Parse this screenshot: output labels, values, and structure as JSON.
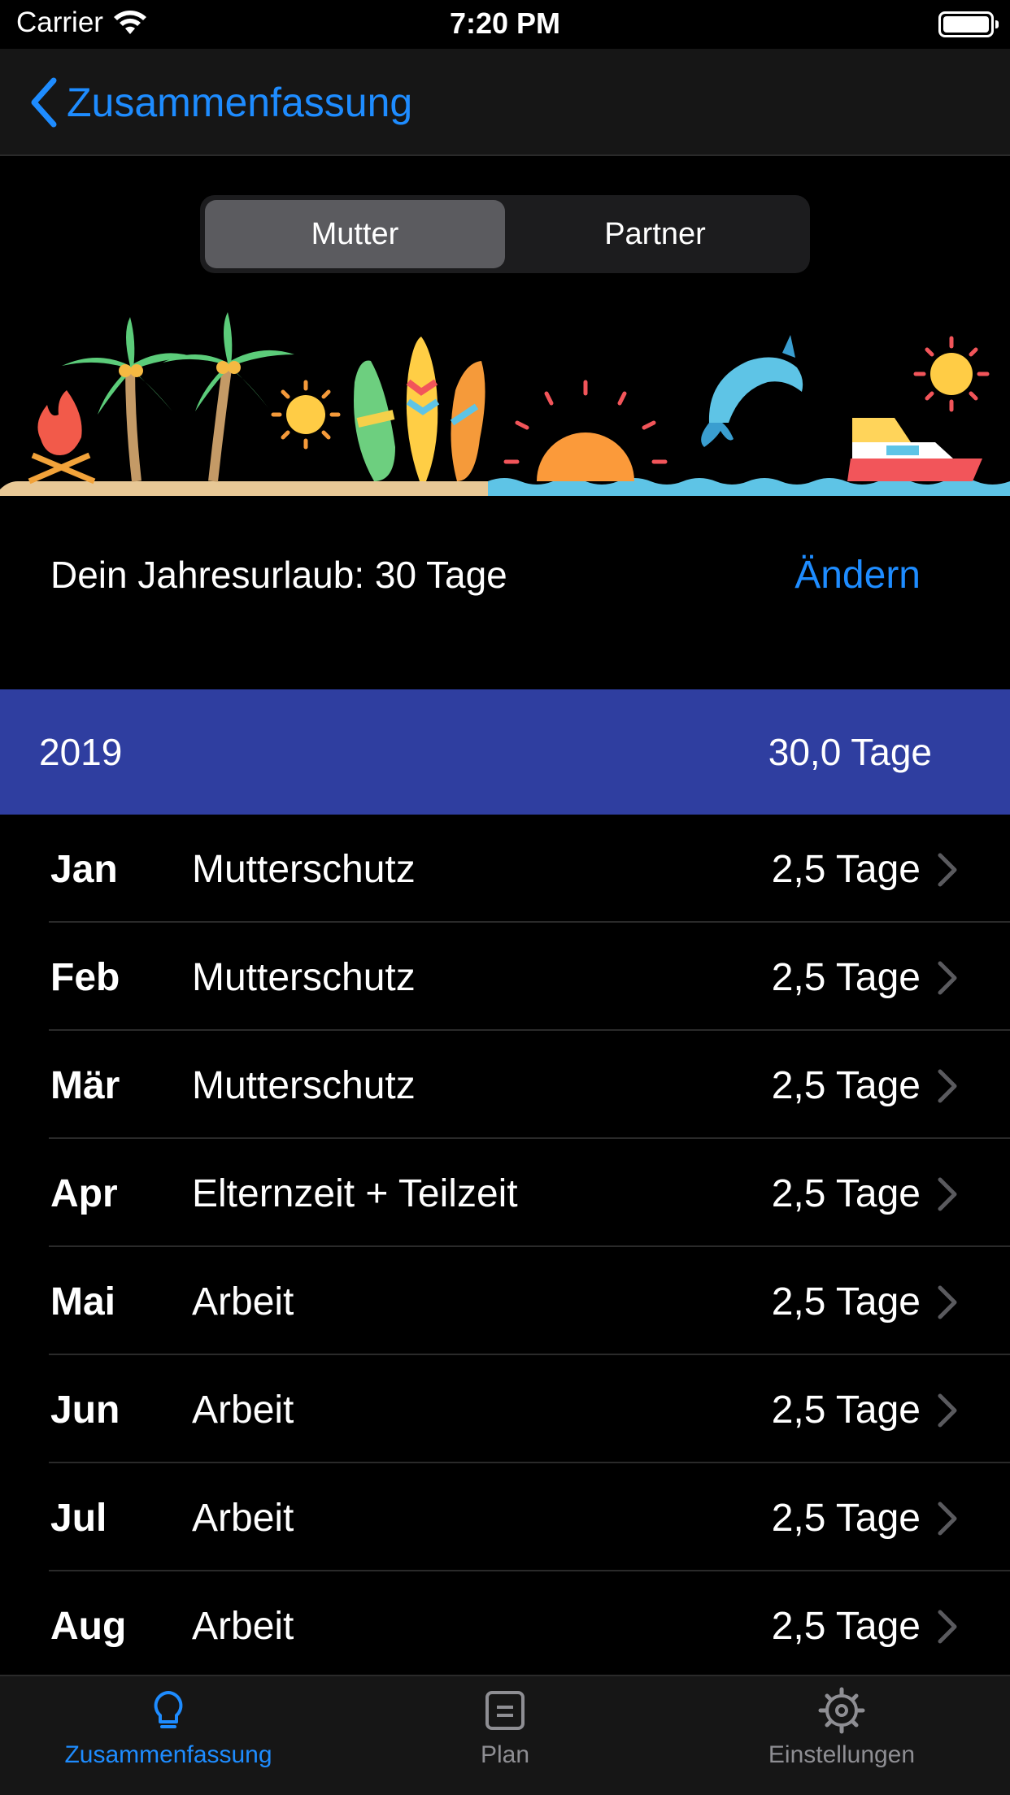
{
  "status": {
    "carrier": "Carrier",
    "time": "7:20 PM"
  },
  "nav": {
    "back_label": "Zusammenfassung"
  },
  "segments": [
    {
      "label": "Mutter",
      "active": true
    },
    {
      "label": "Partner",
      "active": false
    }
  ],
  "vacation": {
    "text": "Dein Jahresurlaub: 30 Tage",
    "change_label": "Ändern"
  },
  "year": {
    "label": "2019",
    "total": "30,0 Tage"
  },
  "months": [
    {
      "name": "Jan",
      "type": "Mutterschutz",
      "days": "2,5 Tage"
    },
    {
      "name": "Feb",
      "type": "Mutterschutz",
      "days": "2,5 Tage"
    },
    {
      "name": "Mär",
      "type": "Mutterschutz",
      "days": "2,5 Tage"
    },
    {
      "name": "Apr",
      "type": "Elternzeit + Teilzeit",
      "days": "2,5 Tage"
    },
    {
      "name": "Mai",
      "type": "Arbeit",
      "days": "2,5 Tage"
    },
    {
      "name": "Jun",
      "type": "Arbeit",
      "days": "2,5 Tage"
    },
    {
      "name": "Jul",
      "type": "Arbeit",
      "days": "2,5 Tage"
    },
    {
      "name": "Aug",
      "type": "Arbeit",
      "days": "2,5 Tage"
    }
  ],
  "tabs": [
    {
      "label": "Zusammenfassung",
      "icon": "lightbulb-icon",
      "active": true
    },
    {
      "label": "Plan",
      "icon": "document-icon",
      "active": false
    },
    {
      "label": "Einstellungen",
      "icon": "gear-icon",
      "active": false
    }
  ],
  "colors": {
    "accent": "#1e8cff",
    "year_header": "#2f3ea0",
    "background": "#000000"
  }
}
